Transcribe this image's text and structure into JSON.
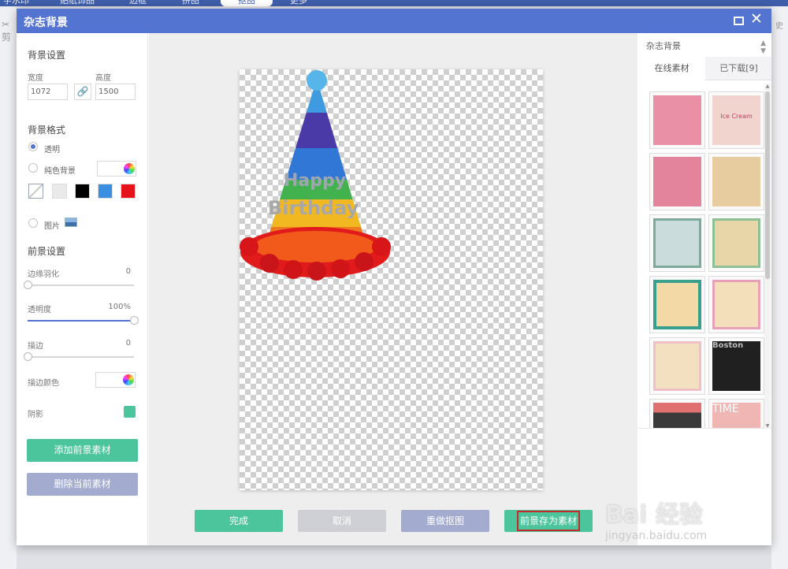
{
  "app": {
    "top_tabs": [
      "字水印",
      "贴纸饰品",
      "边框",
      "拼图",
      "抠图",
      "更多"
    ],
    "left_hint": "✂ 剪",
    "right_hint": "史"
  },
  "dialog": {
    "title": "杂志背景",
    "max_icon": "maximize-icon",
    "close_glyph": "✕"
  },
  "bg_settings": {
    "title": "背景设置",
    "width_label": "宽度",
    "height_label": "高度",
    "width_value": "1072",
    "height_value": "1500",
    "link_glyph": "🔗",
    "format_title": "背景格式",
    "options": {
      "transparent": "透明",
      "solid": "纯色背景",
      "image": "图片"
    },
    "selected": "transparent",
    "swatches": [
      "#eaeaea",
      "#000000",
      "#3b8fe0",
      "#e5141a"
    ]
  },
  "fg_settings": {
    "title": "前景设置",
    "feather_label": "边缘羽化",
    "feather_value": "0",
    "opacity_label": "透明度",
    "opacity_value": "100%",
    "stroke_label": "描边",
    "stroke_value": "0",
    "stroke_color_label": "描边颜色",
    "shadow_label": "阴影",
    "shadow_color": "#4cc49c",
    "add_button": "添加前景素材",
    "delete_button": "删除当前素材"
  },
  "canvas": {
    "hat_text_1": "Happy",
    "hat_text_2": "Birthday"
  },
  "actions": {
    "done": "完成",
    "cancel": "取消",
    "redo": "重做抠图",
    "save": "前景存为素材"
  },
  "materials": {
    "category": "杂志背景",
    "tabs": [
      "在线素材",
      "已下载[9]"
    ],
    "thumbs": [
      {
        "bg": "#e98fa6",
        "text": ""
      },
      {
        "bg": "#f2d4cf",
        "text": "Ice Cream"
      },
      {
        "bg": "#e4839c",
        "text": ""
      },
      {
        "bg": "#e6cc9e",
        "text": ""
      },
      {
        "bg": "#cbdcdc",
        "text": ""
      },
      {
        "bg": "#e8d6a8",
        "text": ""
      },
      {
        "bg": "#3aa08e",
        "text": ""
      },
      {
        "bg": "#f3dfb9",
        "text": ""
      },
      {
        "bg": "#f2e0c0",
        "text": ""
      },
      {
        "bg": "#202020",
        "text": "Boston"
      },
      {
        "bg": "#3a3a3a",
        "text": ""
      },
      {
        "bg": "#f0b6b3",
        "text": "TIME"
      }
    ]
  },
  "watermark": {
    "brand": "Bai 经验",
    "url": "jingyan.baidu.com"
  }
}
